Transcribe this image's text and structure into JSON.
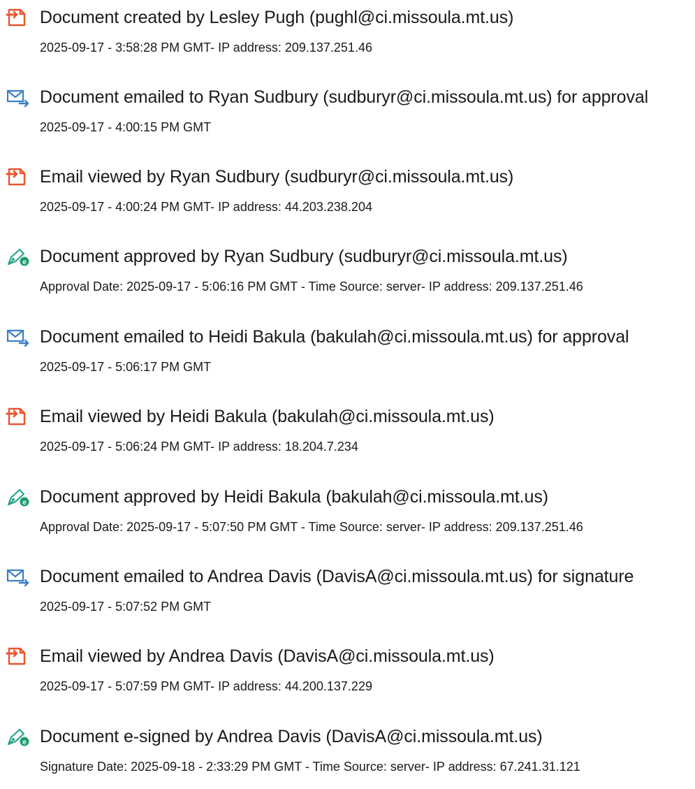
{
  "colors": {
    "doc": "#e8552f",
    "mail": "#3b7fc4",
    "sign_pen": "#27a38f",
    "sign_badge": "#1f9c6e"
  },
  "events": [
    {
      "icon": "document-icon",
      "title": "Document created by Lesley Pugh (pughl@ci.missoula.mt.us)",
      "detail": "2025-09-17 - 3:58:28 PM GMT- IP address: 209.137.251.46"
    },
    {
      "icon": "email-icon",
      "title": "Document emailed to Ryan Sudbury (sudburyr@ci.missoula.mt.us) for approval",
      "detail": "2025-09-17 - 4:00:15 PM GMT"
    },
    {
      "icon": "document-icon",
      "title": "Email viewed by Ryan Sudbury (sudburyr@ci.missoula.mt.us)",
      "detail": "2025-09-17 - 4:00:24 PM GMT- IP address: 44.203.238.204"
    },
    {
      "icon": "pen-icon",
      "title": "Document approved by Ryan Sudbury (sudburyr@ci.missoula.mt.us)",
      "detail": "Approval Date: 2025-09-17 - 5:06:16 PM GMT - Time Source: server- IP address: 209.137.251.46"
    },
    {
      "icon": "email-icon",
      "title": "Document emailed to Heidi Bakula (bakulah@ci.missoula.mt.us) for approval",
      "detail": "2025-09-17 - 5:06:17 PM GMT"
    },
    {
      "icon": "document-icon",
      "title": "Email viewed by Heidi Bakula (bakulah@ci.missoula.mt.us)",
      "detail": "2025-09-17 - 5:06:24 PM GMT- IP address: 18.204.7.234"
    },
    {
      "icon": "pen-icon",
      "title": "Document approved by Heidi Bakula (bakulah@ci.missoula.mt.us)",
      "detail": "Approval Date: 2025-09-17 - 5:07:50 PM GMT - Time Source: server- IP address: 209.137.251.46"
    },
    {
      "icon": "email-icon",
      "title": "Document emailed to Andrea Davis (DavisA@ci.missoula.mt.us) for signature",
      "detail": "2025-09-17 - 5:07:52 PM GMT"
    },
    {
      "icon": "document-icon",
      "title": "Email viewed by Andrea Davis (DavisA@ci.missoula.mt.us)",
      "detail": "2025-09-17 - 5:07:59 PM GMT- IP address: 44.200.137.229"
    },
    {
      "icon": "pen-icon",
      "title": "Document e-signed by Andrea Davis (DavisA@ci.missoula.mt.us)",
      "detail": "Signature Date: 2025-09-18 - 2:33:29 PM GMT - Time Source: server- IP address: 67.241.31.121"
    }
  ]
}
